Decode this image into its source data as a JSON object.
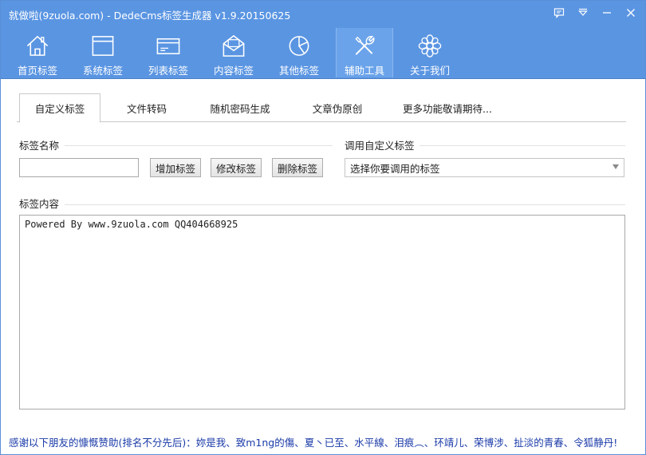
{
  "window": {
    "title": "就做啦(9zuola.com) - DedeCms标签生成器 v1.9.20150625"
  },
  "toolbar": {
    "items": [
      {
        "label": "首页标签",
        "icon": "home-icon"
      },
      {
        "label": "系统标签",
        "icon": "window-icon"
      },
      {
        "label": "列表标签",
        "icon": "card-icon"
      },
      {
        "label": "内容标签",
        "icon": "envelope-icon"
      },
      {
        "label": "其他标签",
        "icon": "pie-chart-icon"
      },
      {
        "label": "辅助工具",
        "icon": "tools-icon",
        "active": true
      },
      {
        "label": "关于我们",
        "icon": "flower-icon"
      }
    ]
  },
  "tabs": [
    {
      "label": "自定义标签",
      "active": true
    },
    {
      "label": "文件转码"
    },
    {
      "label": "随机密码生成"
    },
    {
      "label": "文章伪原创"
    },
    {
      "label": "更多功能敬请期待..."
    }
  ],
  "form": {
    "name_label": "标签名称",
    "name_value": "",
    "add_button": "增加标签",
    "edit_button": "修改标签",
    "delete_button": "删除标签",
    "call_label": "调用自定义标签",
    "select_value": "选择你要调用的标签",
    "content_label": "标签内容",
    "content_value": "Powered By www.9zuola.com QQ404668925"
  },
  "footer": {
    "thanks": "感谢以下朋友的慷慨赞助(排名不分先后)：妳是我、致m1ng的傷、夏丶已至、水平線、泪痕︵、环靖儿、荣博涉、扯淡的青春、令狐静丹!"
  },
  "colors": {
    "titlebar": "#5a95e2",
    "footer_text": "#1a3aa8"
  }
}
